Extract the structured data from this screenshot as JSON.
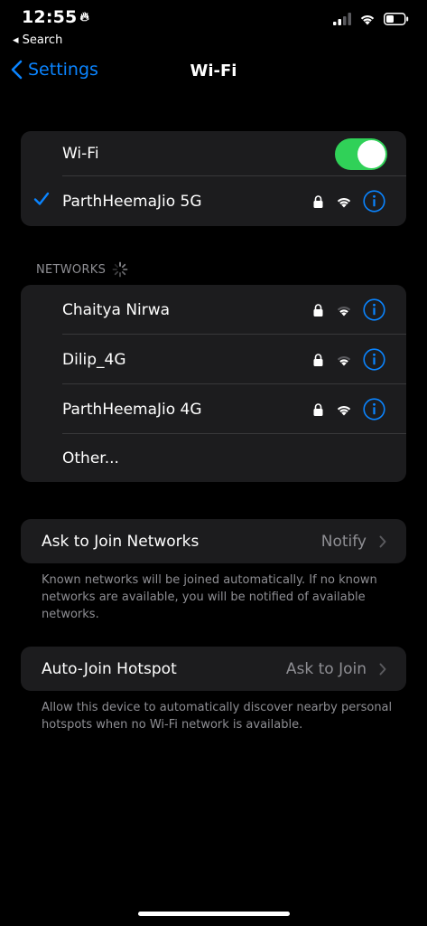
{
  "status_bar": {
    "time": "12:55",
    "back_label": "◂ Search"
  },
  "nav": {
    "back_label": "Settings",
    "title": "Wi-Fi"
  },
  "wifi_group": {
    "toggle_label": "Wi-Fi",
    "toggle_on": true,
    "connected_network": "ParthHeemaJio 5G"
  },
  "networks_section": {
    "header": "NETWORKS",
    "items": [
      {
        "name": "Chaitya Nirwa",
        "secured": true
      },
      {
        "name": "Dilip_4G",
        "secured": true
      },
      {
        "name": "ParthHeemaJio 4G",
        "secured": true
      }
    ],
    "other_label": "Other..."
  },
  "ask_to_join": {
    "label": "Ask to Join Networks",
    "value": "Notify",
    "footnote": "Known networks will be joined automatically. If no known networks are available, you will be notified of available networks."
  },
  "auto_join_hotspot": {
    "label": "Auto-Join Hotspot",
    "value": "Ask to Join",
    "footnote": "Allow this device to automatically discover nearby personal hotspots when no Wi-Fi network is available."
  },
  "colors": {
    "accent": "#0a84ff",
    "toggle_on": "#30d158",
    "cell_bg": "#1c1c1e",
    "secondary_text": "#8e8e93"
  }
}
